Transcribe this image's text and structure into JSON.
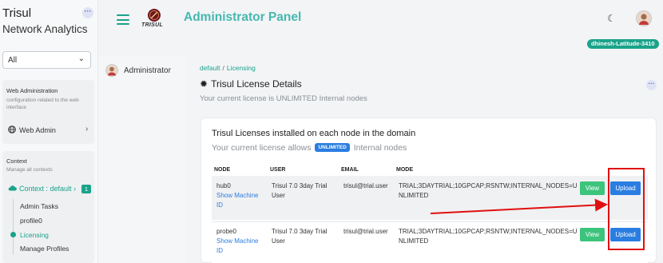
{
  "sidebar": {
    "brand_title": "Trisul",
    "brand_subtitle": "Network Analytics",
    "context_select": {
      "value": "All"
    },
    "web_admin": {
      "title": "Web Administration",
      "description": "configuration related to the web interface",
      "item_label": "Web Admin"
    },
    "context": {
      "title": "Context",
      "description": "Manage all contexts",
      "current_label": "Context : default",
      "badge_count": "1",
      "items": [
        {
          "label": "Admin Tasks"
        },
        {
          "label": "profile0"
        },
        {
          "label": "Licensing"
        },
        {
          "label": "Manage Profiles"
        }
      ]
    }
  },
  "header": {
    "logo_text": "TRISUL",
    "title": "Administrator Panel",
    "hostname": "dhinesh-Latitude-3410"
  },
  "sub_sidebar": {
    "user_label": "Administrator"
  },
  "breadcrumb": {
    "items": [
      "default",
      "Licensing"
    ]
  },
  "page": {
    "title": "Trisul License Details",
    "subtitle": "Your current license is UNLIMITED Internal nodes"
  },
  "license_card": {
    "title": "Trisul Licenses installed on each node in the domain",
    "sub_prefix": "Your current license allows",
    "sub_badge": "UNLIMITED",
    "sub_suffix": "Internal nodes",
    "columns": [
      "NODE",
      "USER",
      "EMAIL",
      "MODE"
    ],
    "rows": [
      {
        "node": "hub0",
        "link_label": "Show Machine ID",
        "user": "Trisul 7.0 3day Trial User",
        "email": "trisul@trial.user",
        "mode": "TRIAL;3DAYTRIAL;10GPCAP;RSNTW;INTERNAL_NODES=UNLIMITED",
        "view_label": "View",
        "upload_label": "Upload"
      },
      {
        "node": "probe0",
        "link_label": "Show Machine ID",
        "user": "Trisul 7.0 3day Trial User",
        "email": "trisul@trial.user",
        "mode": "TRIAL;3DAYTRIAL;10GPCAP;RSNTW;INTERNAL_NODES=UNLIMITED",
        "view_label": "View",
        "upload_label": "Upload"
      }
    ]
  },
  "colors": {
    "accent_teal": "#1aa38a",
    "title_teal": "#47b7ae",
    "primary_blue": "#2a7de1",
    "success_green": "#3cc47c",
    "annotation_red": "#e01010"
  },
  "icons": [
    "menu-icon",
    "moon-icon",
    "user-avatar",
    "globe-icon",
    "cloud-icon",
    "gear-icon",
    "more-icon",
    "chevron-down-icon",
    "chevron-right-icon"
  ]
}
